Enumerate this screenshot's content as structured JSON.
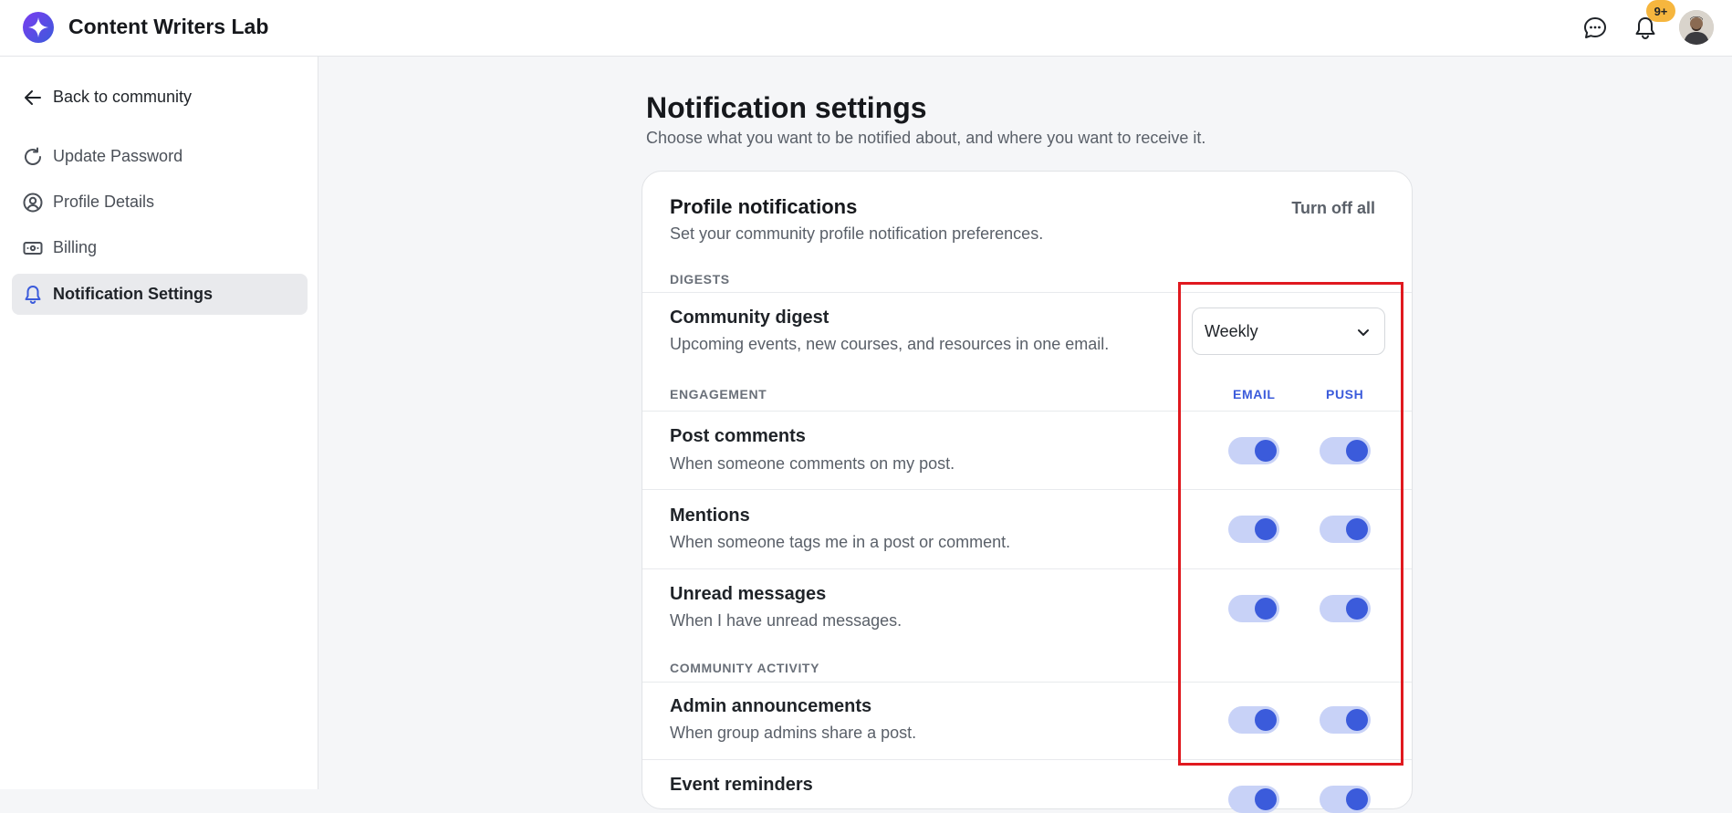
{
  "header": {
    "brand": "Content Writers Lab",
    "badge_count": "9+",
    "icons": [
      "sparkle-logo-icon",
      "chat-bubble-icon",
      "bell-icon",
      "user-avatar"
    ]
  },
  "sidebar": {
    "back_label": "Back to community",
    "items": [
      {
        "label": "Update Password",
        "icon": "refresh-icon"
      },
      {
        "label": "Profile Details",
        "icon": "user-circle-icon"
      },
      {
        "label": "Billing",
        "icon": "billing-card-icon"
      },
      {
        "label": "Notification Settings",
        "icon": "bell-icon",
        "active": true
      }
    ]
  },
  "main": {
    "title": "Notification settings",
    "subtitle": "Choose what you want to be notified about, and where you want to receive it.",
    "card": {
      "title": "Profile notifications",
      "subtitle": "Set your community profile notification preferences.",
      "turn_off_all": "Turn off all",
      "sections": {
        "digests": "DIGESTS",
        "engagement": "ENGAGEMENT",
        "community_activity": "COMMUNITY ACTIVITY"
      },
      "columns": {
        "email": "EMAIL",
        "push": "PUSH"
      },
      "digest": {
        "title": "Community digest",
        "desc": "Upcoming events, new courses, and resources in one email.",
        "selected": "Weekly"
      },
      "rows": [
        {
          "title": "Post comments",
          "desc": "When someone comments on my post.",
          "email": true,
          "push": true
        },
        {
          "title": "Mentions",
          "desc": "When someone tags me in a post or comment.",
          "email": true,
          "push": true
        },
        {
          "title": "Unread messages",
          "desc": "When I have unread messages.",
          "email": true,
          "push": true
        },
        {
          "title": "Admin announcements",
          "desc": "When group admins share a post.",
          "email": true,
          "push": true
        },
        {
          "title": "Event reminders",
          "desc": "",
          "email": true,
          "push": true
        }
      ]
    }
  },
  "colors": {
    "accent": "#3b5bdb",
    "toggle_track": "#c8d2f7",
    "badge": "#f6b63e",
    "highlight": "#e0191f"
  }
}
